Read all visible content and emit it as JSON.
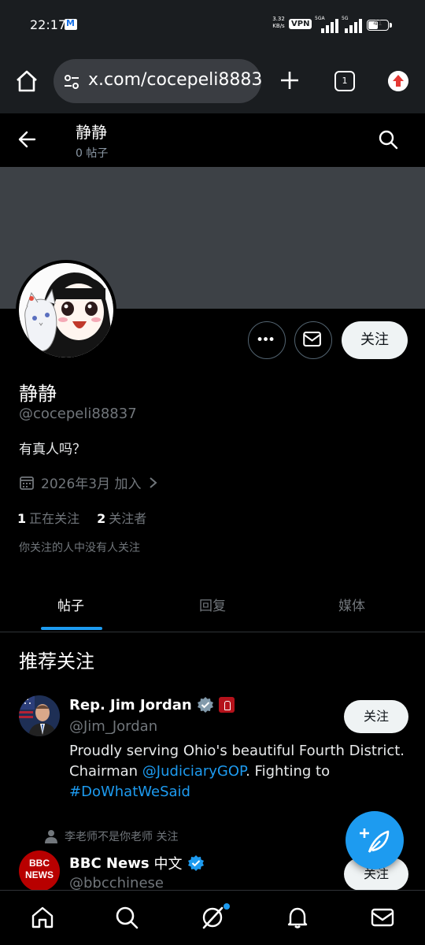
{
  "status_bar": {
    "time": "22:17",
    "net_speed": "3.32",
    "net_unit": "KB/s",
    "vpn": "VPN",
    "sim1": "5GA",
    "sim2": "5G",
    "battery": "41"
  },
  "browser": {
    "url": "x.com/cocepeli88837",
    "tab_count": "1"
  },
  "header": {
    "name": "静静",
    "post_count": "0 帖子"
  },
  "profile": {
    "display_name": "静静",
    "handle": "@cocepeli88837",
    "bio": "有真人吗？",
    "joined": "2026年3月 加入",
    "following_count": "1",
    "following_label": "正在关注",
    "followers_count": "2",
    "followers_label": "关注者",
    "mutual_note": "你关注的人中没有人关注",
    "follow_label": "关注"
  },
  "tabs": [
    {
      "label": "帖子",
      "active": true
    },
    {
      "label": "回复",
      "active": false
    },
    {
      "label": "媒体",
      "active": false
    }
  ],
  "recommendations": {
    "title": "推荐关注",
    "items": [
      {
        "name": "Rep. Jim Jordan",
        "handle": "@Jim_Jordan",
        "bio_part1": "Proudly serving Ohio's beautiful Fourth District. Chairman ",
        "bio_link1": "@JudiciaryGOP",
        "bio_part2": ". Fighting to ",
        "bio_link2": "#DoWhatWeSaid",
        "follow_label": "关注"
      },
      {
        "social_context": "李老师不是你老师 关注",
        "name": "BBC News",
        "name_cn": "中文",
        "handle": "@bbcchinese",
        "follow_label": "关注",
        "logo_line1": "BBC",
        "logo_line2": "NEWS"
      }
    ]
  },
  "colors": {
    "accent": "#1d9bf0",
    "background": "#000000",
    "banner": "#3d4146",
    "muted_text": "#71767b"
  }
}
